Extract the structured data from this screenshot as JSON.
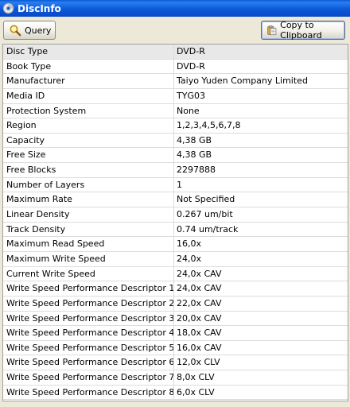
{
  "window": {
    "title": "DiscInfo",
    "icon": "disc-icon"
  },
  "toolbar": {
    "query_label": "Query",
    "query_icon": "magnifier-icon",
    "copy_label": "Copy to Clipboard",
    "copy_icon": "clipboard-icon"
  },
  "properties": [
    {
      "name": "Disc Type",
      "value": "DVD-R"
    },
    {
      "name": "Book Type",
      "value": "DVD-R"
    },
    {
      "name": "Manufacturer",
      "value": "Taiyo Yuden Company Limited"
    },
    {
      "name": "Media ID",
      "value": "TYG03"
    },
    {
      "name": "Protection System",
      "value": "None"
    },
    {
      "name": "Region",
      "value": "1,2,3,4,5,6,7,8"
    },
    {
      "name": "Capacity",
      "value": "4,38 GB"
    },
    {
      "name": "Free Size",
      "value": "4,38 GB"
    },
    {
      "name": "Free Blocks",
      "value": "2297888"
    },
    {
      "name": "Number of Layers",
      "value": "1"
    },
    {
      "name": "Maximum Rate",
      "value": "Not Specified"
    },
    {
      "name": "Linear Density",
      "value": "0.267 um/bit"
    },
    {
      "name": "Track Density",
      "value": "0.74 um/track"
    },
    {
      "name": "Maximum Read Speed",
      "value": "16,0x"
    },
    {
      "name": "Maximum Write Speed",
      "value": "24,0x"
    },
    {
      "name": "Current Write Speed",
      "value": "24,0x CAV"
    },
    {
      "name": "Write Speed Performance Descriptor 1",
      "value": "24,0x CAV"
    },
    {
      "name": "Write Speed Performance Descriptor 2",
      "value": "22,0x CAV"
    },
    {
      "name": "Write Speed Performance Descriptor 3",
      "value": "20,0x CAV"
    },
    {
      "name": "Write Speed Performance Descriptor 4",
      "value": "18,0x CAV"
    },
    {
      "name": "Write Speed Performance Descriptor 5",
      "value": "16,0x CAV"
    },
    {
      "name": "Write Speed Performance Descriptor 6",
      "value": "12,0x CLV"
    },
    {
      "name": "Write Speed Performance Descriptor 7",
      "value": "8,0x CLV"
    },
    {
      "name": "Write Speed Performance Descriptor 8",
      "value": "6,0x CLV"
    }
  ]
}
